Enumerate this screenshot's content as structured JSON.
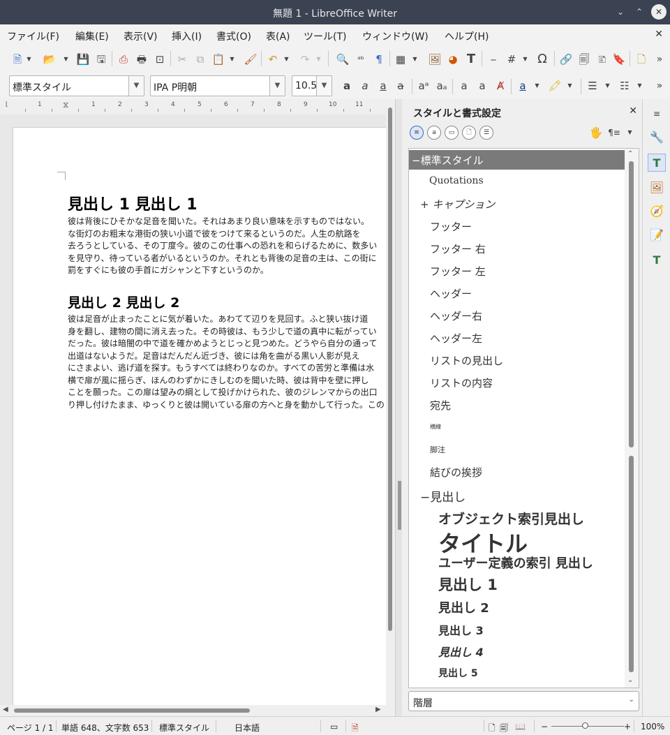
{
  "window": {
    "title": "無題 1 - LibreOffice Writer"
  },
  "menu": [
    "ファイル(F)",
    "編集(E)",
    "表示(V)",
    "挿入(I)",
    "書式(O)",
    "表(A)",
    "ツール(T)",
    "ウィンドウ(W)",
    "ヘルプ(H)"
  ],
  "formatting": {
    "paragraph_style": "標準スタイル",
    "font_name": "IPA P明朝",
    "font_size": "10.5"
  },
  "ruler": {
    "numbers": [
      "1",
      "1",
      "2",
      "3",
      "4",
      "5",
      "6",
      "7",
      "8",
      "9",
      "10",
      "11"
    ]
  },
  "document": {
    "heading1": "見出し 1 見出し 1",
    "para1": [
      "彼は背後にひそかな足音を聞いた。それはあまり良い意味を示すものではない。",
      "な街灯のお粗末な港街の狭い小道で彼をつけて来るというのだ。人生の航路を",
      "去ろうとしている、その丁度今。彼のこの仕事への恐れを和らげるために、数多い",
      "を見守り、待っている者がいるというのか。それとも背後の足音の主は、この街に",
      "罰をすぐにも彼の手首にガシャンと下すというのか。"
    ],
    "heading2": "見出し 2 見出し 2",
    "para2": [
      "彼は足音が止まったことに気が着いた。あわてて辺りを見回す。ふと狭い抜け道",
      "身を翻し、建物の間に消え去った。その時彼は、もう少しで道の真中に転がってい",
      "だった。彼は暗闇の中で道を確かめようとじっと見つめた。どうやら自分の通って",
      "出道はないようだ。足音はだんだん近づき、彼には角を曲がる黒い人影が見え",
      "にさまよい、逃げ道を探す。もうすべては終わりなのか。すべての苦労と準備は水",
      "横で扉が風に揺らぎ、ほんのわずかにきしむのを聞いた時、彼は背中を壁に押し",
      "ことを願った。この扉は望みの綱として投げかけられた、彼のジレンマからの出口",
      "り押し付けたまま、ゆっくりと彼は開いている扉の方へと身を動かして行った。この"
    ]
  },
  "sidebar": {
    "title": "スタイルと書式設定",
    "styles": [
      {
        "label": "標準スタイル",
        "prefix": "−"
      },
      {
        "label": "Quotations",
        "prefix": ""
      },
      {
        "label": "キャプション",
        "prefix": "+"
      },
      {
        "label": "フッター",
        "prefix": ""
      },
      {
        "label": "フッター 右",
        "prefix": ""
      },
      {
        "label": "フッター 左",
        "prefix": ""
      },
      {
        "label": "ヘッダー",
        "prefix": ""
      },
      {
        "label": "ヘッダー右",
        "prefix": ""
      },
      {
        "label": "ヘッダー左",
        "prefix": ""
      },
      {
        "label": "リストの見出し",
        "prefix": ""
      },
      {
        "label": "リストの内容",
        "prefix": ""
      },
      {
        "label": "宛先",
        "prefix": ""
      },
      {
        "label": "横線",
        "prefix": ""
      },
      {
        "label": "脚注",
        "prefix": ""
      },
      {
        "label": "結びの挨拶",
        "prefix": ""
      },
      {
        "label": "見出し",
        "prefix": "−"
      },
      {
        "label": "オブジェクト索引見出し",
        "prefix": ""
      },
      {
        "label": "タイトル",
        "prefix": ""
      },
      {
        "label": "ユーザー定義の索引 見出し",
        "prefix": ""
      },
      {
        "label": "見出し 1",
        "prefix": ""
      },
      {
        "label": "見出し 2",
        "prefix": ""
      },
      {
        "label": "見出し 3",
        "prefix": ""
      },
      {
        "label": "見出し 4",
        "prefix": ""
      },
      {
        "label": "見出し 5",
        "prefix": ""
      }
    ],
    "filter": "階層"
  },
  "status": {
    "page": "ページ 1 / 1",
    "words": "単語 648、文字数 653",
    "style": "標準スタイル",
    "language": "日本語",
    "zoom": "100%"
  },
  "colors": {
    "titlebar": "#3b4252",
    "selected": "#7a7a7a",
    "accent": "#3a6bc4"
  }
}
